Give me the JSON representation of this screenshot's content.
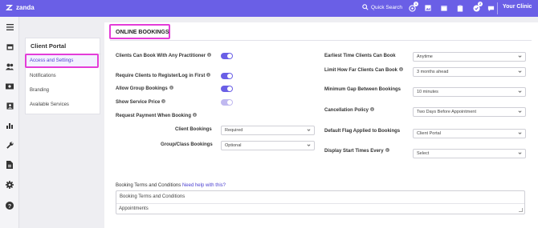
{
  "app": {
    "name": "zanda",
    "clinic": "Your Clinic"
  },
  "topbar": {
    "quick_search": "Quick Search",
    "badges": {
      "notifications": "1",
      "tasks": "2"
    }
  },
  "subnav": {
    "title": "Client Portal",
    "items": [
      {
        "label": "Access and Settings",
        "active": true
      },
      {
        "label": "Notifications"
      },
      {
        "label": "Branding"
      },
      {
        "label": "Available Services"
      }
    ]
  },
  "page": {
    "title": "ONLINE BOOKINGS"
  },
  "left_settings": {
    "book_any_practitioner": "Clients Can Book With Any Practitioner",
    "require_register": "Require Clients to Register/Log in First",
    "allow_group": "Allow Group Bookings",
    "show_price": "Show Service Price",
    "request_payment": "Request Payment When Booking",
    "client_bookings": {
      "label": "Client Bookings",
      "value": "Required"
    },
    "group_bookings": {
      "label": "Group/Class Bookings",
      "value": "Optional"
    }
  },
  "right_settings": {
    "earliest_time": {
      "label": "Earliest Time Clients Can Book",
      "value": "Anytime"
    },
    "limit_ahead": {
      "label": "Limit How Far Clients Can Book",
      "value": "3 months ahead"
    },
    "min_gap": {
      "label": "Minimum Gap Between Bookings",
      "value": "10 minutes"
    },
    "cancellation": {
      "label": "Cancellation Policy",
      "value": "Two Days Before Appointment"
    },
    "default_flag": {
      "label": "Default Flag Applied to Bookings",
      "value": "Client Portal"
    },
    "display_start": {
      "label": "Display Start Times Every",
      "value": "Select"
    }
  },
  "terms": {
    "label": "Booking Terms and Conditions",
    "help": "Need help with this?",
    "text": "Booking Terms and Conditions",
    "next_line": "Appointments"
  },
  "colors": {
    "brand": "#6a5fe6",
    "highlight": "#e43cd8"
  }
}
